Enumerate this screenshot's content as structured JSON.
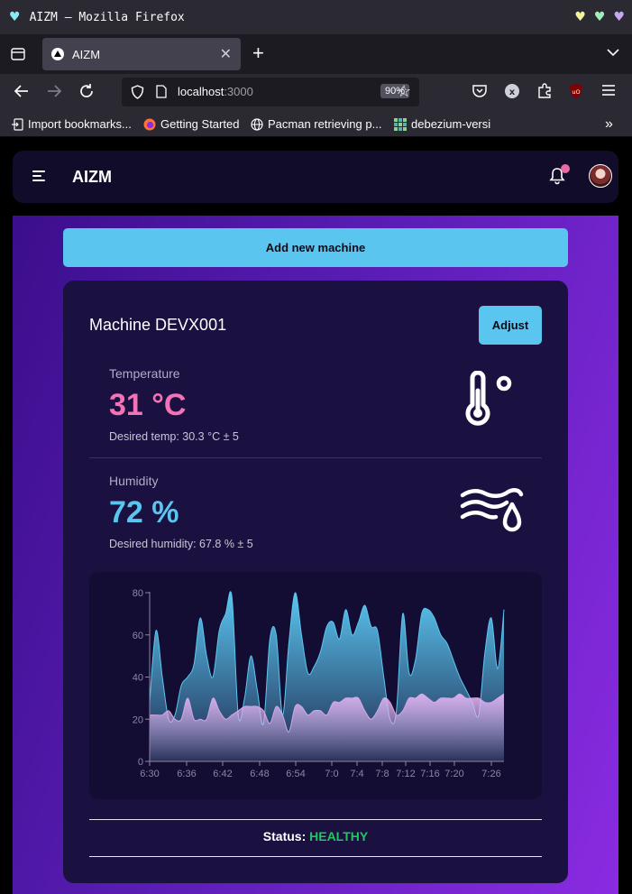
{
  "window": {
    "title": "AIZM — Mozilla Firefox"
  },
  "tab": {
    "label": "AIZM",
    "close": "✕"
  },
  "toolbar": {
    "url_host": "localhost",
    "url_port": ":3000",
    "zoom": "90%"
  },
  "bookmarks": [
    {
      "label": "Import bookmarks..."
    },
    {
      "label": "Getting Started"
    },
    {
      "label": "Pacman retrieving p..."
    },
    {
      "label": "debezium-versi"
    }
  ],
  "app": {
    "title": "AIZM",
    "add_button": "Add new machine"
  },
  "machine": {
    "title": "Machine DEVX001",
    "adjust_button": "Adjust",
    "temperature": {
      "label": "Temperature",
      "value": "31 °C",
      "desired": "Desired temp: 30.3 °C ± 5",
      "color": "#f472b6"
    },
    "humidity": {
      "label": "Humidity",
      "value": "72 %",
      "desired": "Desired humidity: 67.8 % ± 5",
      "color": "#5ac6f0"
    },
    "status_label": "Status:",
    "status_value": "HEALTHY"
  },
  "chart_data": {
    "type": "area",
    "title": "",
    "xlabel": "",
    "ylabel": "",
    "ylim": [
      0,
      80
    ],
    "yticks": [
      0,
      20,
      40,
      60,
      80
    ],
    "xticks": [
      "6:30",
      "6:36",
      "6:42",
      "6:48",
      "6:54",
      "7:0",
      "7:4",
      "7:8",
      "7:12",
      "7:16",
      "7:20",
      "7:26"
    ],
    "grid": false,
    "x": [
      0,
      1,
      2,
      3,
      4,
      5,
      6,
      7,
      8,
      9,
      10,
      11,
      12,
      13,
      14,
      15,
      16,
      17,
      18,
      19,
      20,
      21,
      22,
      23,
      24,
      25,
      26,
      27,
      28,
      29,
      30,
      31,
      32,
      33,
      34,
      35,
      36,
      37,
      38,
      39,
      40,
      41,
      42,
      43,
      44,
      45,
      46,
      47,
      48,
      49,
      50,
      51,
      52,
      53,
      54,
      55,
      56
    ],
    "series": [
      {
        "color": "#5ac6f0",
        "values": [
          28,
          62,
          40,
          20,
          22,
          36,
          40,
          46,
          68,
          50,
          40,
          62,
          70,
          78,
          22,
          30,
          50,
          34,
          18,
          58,
          60,
          22,
          56,
          80,
          60,
          42,
          45,
          52,
          64,
          66,
          58,
          72,
          60,
          66,
          74,
          64,
          62,
          40,
          20,
          24,
          70,
          42,
          48,
          70,
          72,
          68,
          60,
          56,
          48,
          40,
          34,
          28,
          22,
          52,
          68,
          44,
          72
        ]
      },
      {
        "color": "#d4a6e8",
        "values": [
          22,
          22,
          22,
          24,
          20,
          20,
          30,
          20,
          20,
          20,
          30,
          24,
          20,
          22,
          24,
          26,
          26,
          26,
          24,
          18,
          26,
          22,
          14,
          26,
          26,
          22,
          24,
          24,
          22,
          28,
          28,
          30,
          30,
          30,
          24,
          20,
          24,
          30,
          28,
          22,
          24,
          30,
          30,
          32,
          30,
          28,
          30,
          30,
          30,
          32,
          30,
          30,
          30,
          28,
          28,
          30,
          32
        ]
      }
    ]
  }
}
